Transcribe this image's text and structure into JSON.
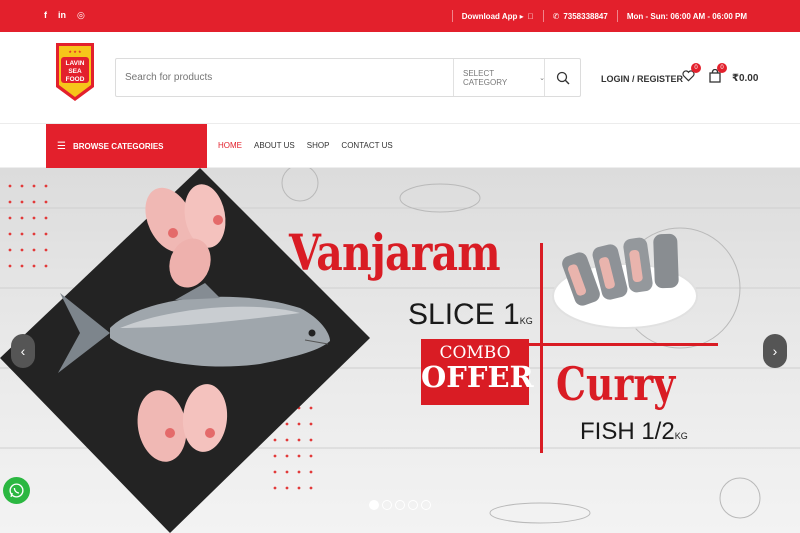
{
  "topbar": {
    "socials": [
      "f",
      "in",
      "◎"
    ],
    "download": "Download App ▸ ",
    "phone": "7358338847",
    "hours": "Mon - Sun: 06:00 AM - 06:00 PM"
  },
  "logo": {
    "line1": "LAVIN",
    "line2": "SEA",
    "line3": "FOOD"
  },
  "search": {
    "placeholder": "Search for products",
    "category": "SELECT CATEGORY"
  },
  "account": {
    "login": "LOGIN / REGISTER",
    "wishlist_count": "0",
    "cart_count": "0",
    "cart_total": "₹0.00"
  },
  "nav": {
    "browse": "BROWSE CATEGORIES",
    "links": [
      "HOME",
      "ABOUT US",
      "SHOP",
      "CONTACT US"
    ]
  },
  "hero": {
    "title": "Vanjaram",
    "slice": "SLICE 1",
    "slice_unit": "KG",
    "combo": "COMBO",
    "offer": "OFFER",
    "curry": "Curry",
    "fish": "FISH 1/2",
    "fish_unit": "KG",
    "slides": 5,
    "active_slide": 0
  },
  "colors": {
    "brand_red": "#e3202c",
    "title_red": "#d91c24",
    "whatsapp": "#2bb741"
  }
}
